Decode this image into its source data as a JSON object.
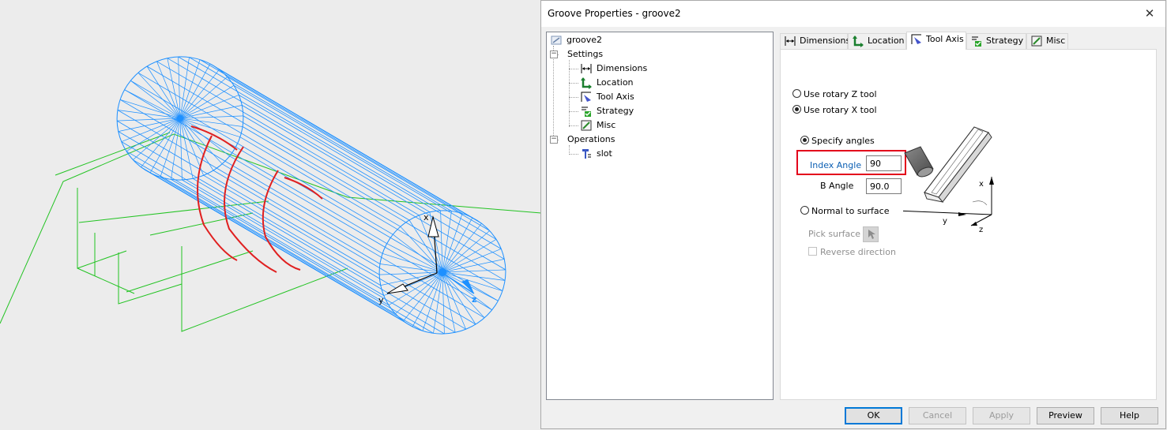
{
  "dialog": {
    "title": "Groove Properties - groove2",
    "close_glyph": "✕"
  },
  "tree": {
    "root": "groove2",
    "settings": "Settings",
    "settings_items": [
      "Dimensions",
      "Location",
      "Tool Axis",
      "Strategy",
      "Misc"
    ],
    "operations": "Operations",
    "operations_items": [
      "slot"
    ]
  },
  "tabs": [
    "Dimensions",
    "Location",
    "Tool Axis",
    "Strategy",
    "Misc"
  ],
  "active_tab": "Tool Axis",
  "tool_axis": {
    "rotary_z_label": "Use rotary Z tool",
    "rotary_x_label": "Use rotary X tool",
    "rotary_selected": "Use rotary X tool",
    "specify_angles_label": "Specify angles",
    "index_angle_label": "Index Angle",
    "index_angle_value": "90",
    "b_angle_label": "B Angle",
    "b_angle_value": "90.0",
    "normal_to_surface_label": "Normal to surface",
    "pick_surface_label": "Pick surface",
    "reverse_direction_label": "Reverse direction",
    "diagram_axis_labels": {
      "x": "x",
      "y": "y",
      "z": "z"
    }
  },
  "viewport": {
    "triad_labels": {
      "x": "x",
      "y": "y",
      "z": "z"
    }
  },
  "buttons": {
    "ok": "OK",
    "cancel": "Cancel",
    "apply": "Apply",
    "preview": "Preview",
    "help": "Help"
  },
  "colors": {
    "wireframe": "#1e90ff",
    "groove_path": "#e02020",
    "stock_outline": "#22c322",
    "highlight_box": "#e3001b",
    "link_blue": "#0b5fb3"
  }
}
